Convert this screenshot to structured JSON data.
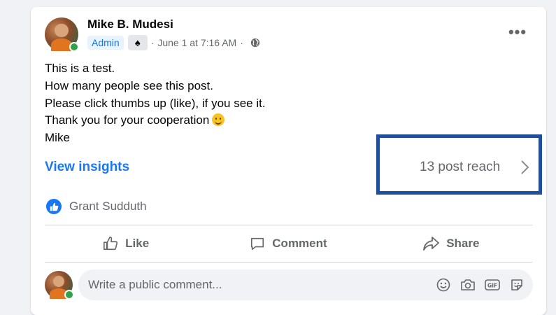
{
  "post": {
    "author": "Mike B. Mudesi",
    "role_badge": "Admin",
    "spade_badge": "♠",
    "separator": "·",
    "date": "June 1 at 7:16 AM",
    "separator2": "·",
    "text_lines": [
      "This is a test.",
      "How many people see this post.",
      "Please click thumbs up (like), if you see it.",
      "Thank you for your cooperation",
      "Mike"
    ],
    "more_label": "•••"
  },
  "insights": {
    "view_label": "View insights",
    "reach_label": "13 post reach"
  },
  "reactions": {
    "names": "Grant Sudduth"
  },
  "actions": {
    "like": "Like",
    "comment": "Comment",
    "share": "Share"
  },
  "comment_box": {
    "placeholder": "Write a public comment..."
  },
  "icons": {
    "online": "online-status-icon",
    "globe": "globe-icon",
    "emoji": "emoji-icon",
    "camera": "camera-icon",
    "gif": "gif-icon",
    "sticker": "sticker-icon"
  },
  "colors": {
    "accent": "#1877f2",
    "highlight_box": "#1f4e9c",
    "online": "#31a24c"
  }
}
